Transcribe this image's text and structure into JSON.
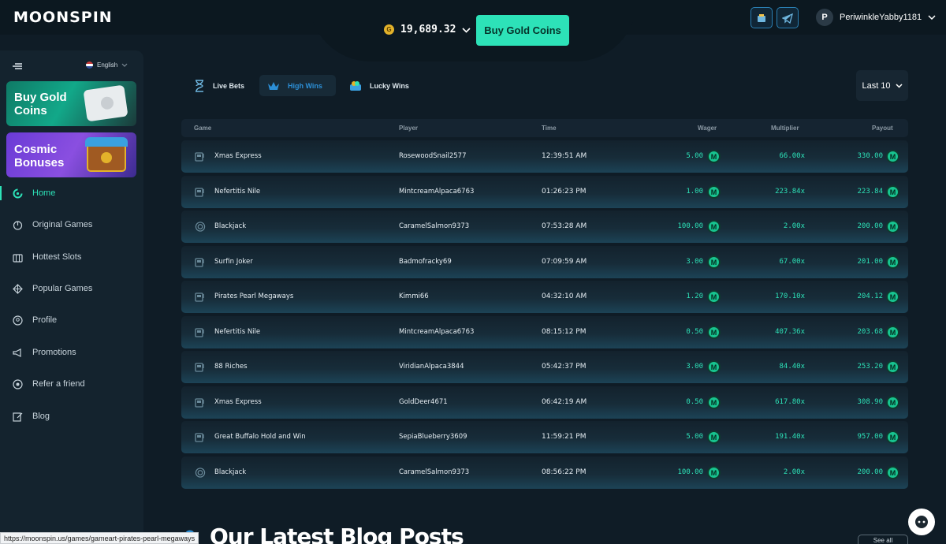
{
  "brand": {
    "logo": "MOONSPIN"
  },
  "header": {
    "balance": "19,689.32",
    "coin_symbol": "G",
    "buy_label": "Buy Gold Coins",
    "username": "PeriwinkleYabby1181",
    "avatar_letter": "P"
  },
  "sidebar": {
    "language": "English",
    "promo_buy": "Buy Gold Coins",
    "promo_bonus": "Cosmic Bonuses",
    "items": [
      {
        "label": "Home",
        "icon": "home-icon"
      },
      {
        "label": "Original Games",
        "icon": "original-games-icon"
      },
      {
        "label": "Hottest Slots",
        "icon": "slots-icon"
      },
      {
        "label": "Popular Games",
        "icon": "popular-games-icon"
      },
      {
        "label": "Profile",
        "icon": "profile-icon"
      },
      {
        "label": "Promotions",
        "icon": "promotions-icon"
      },
      {
        "label": "Refer a friend",
        "icon": "refer-icon"
      },
      {
        "label": "Blog",
        "icon": "blog-icon"
      }
    ]
  },
  "tabs": {
    "live": "Live Bets",
    "high": "High Wins",
    "lucky": "Lucky Wins",
    "filter": "Last 10"
  },
  "table": {
    "headers": {
      "game": "Game",
      "player": "Player",
      "time": "Time",
      "wager": "Wager",
      "multiplier": "Multiplier",
      "payout": "Payout"
    },
    "currency": "M",
    "rows": [
      {
        "game": "Xmas Express",
        "player": "RosewoodSnail2577",
        "time": "12:39:51 AM",
        "wager": "5.00",
        "multiplier": "66.00x",
        "payout": "330.00",
        "type": "slot"
      },
      {
        "game": "Nefertitis Nile",
        "player": "MintcreamAlpaca6763",
        "time": "01:26:23 PM",
        "wager": "1.00",
        "multiplier": "223.84x",
        "payout": "223.84",
        "type": "slot"
      },
      {
        "game": "Blackjack",
        "player": "CaramelSalmon9373",
        "time": "07:53:28 AM",
        "wager": "100.00",
        "multiplier": "2.00x",
        "payout": "200.00",
        "type": "table"
      },
      {
        "game": "Surfin Joker",
        "player": "Badmofracky69",
        "time": "07:09:59 AM",
        "wager": "3.00",
        "multiplier": "67.00x",
        "payout": "201.00",
        "type": "slot"
      },
      {
        "game": "Pirates Pearl Megaways",
        "player": "Kimmi66",
        "time": "04:32:10 AM",
        "wager": "1.20",
        "multiplier": "170.10x",
        "payout": "204.12",
        "type": "slot"
      },
      {
        "game": "Nefertitis Nile",
        "player": "MintcreamAlpaca6763",
        "time": "08:15:12 PM",
        "wager": "0.50",
        "multiplier": "407.36x",
        "payout": "203.68",
        "type": "slot"
      },
      {
        "game": "88 Riches",
        "player": "ViridianAlpaca3844",
        "time": "05:42:37 PM",
        "wager": "3.00",
        "multiplier": "84.40x",
        "payout": "253.20",
        "type": "slot"
      },
      {
        "game": "Xmas Express",
        "player": "GoldDeer4671",
        "time": "06:42:19 AM",
        "wager": "0.50",
        "multiplier": "617.80x",
        "payout": "308.90",
        "type": "slot"
      },
      {
        "game": "Great Buffalo Hold and Win",
        "player": "SepiaBlueberry3609",
        "time": "11:59:21 PM",
        "wager": "5.00",
        "multiplier": "191.40x",
        "payout": "957.00",
        "type": "slot"
      },
      {
        "game": "Blackjack",
        "player": "CaramelSalmon9373",
        "time": "08:56:22 PM",
        "wager": "100.00",
        "multiplier": "2.00x",
        "payout": "200.00",
        "type": "table"
      }
    ]
  },
  "footer": {
    "status_url": "https://moonspin.us/games/gameart-pirates-pearl-megaways",
    "blog_title": "Our Latest Blog Posts",
    "see_all": "See all"
  },
  "colors": {
    "accent": "#2de2b8",
    "tab_active": "#2c8fd6",
    "background": "#0f1c26"
  }
}
